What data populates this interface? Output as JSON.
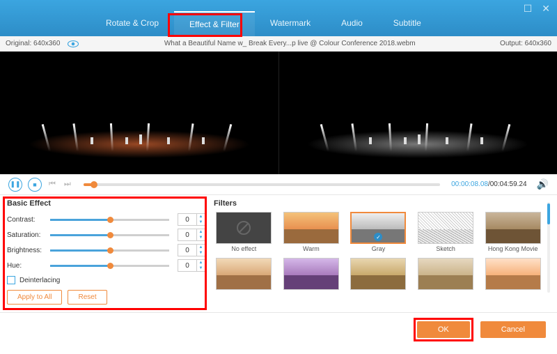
{
  "tabs": {
    "rotate": "Rotate & Crop",
    "effect": "Effect & Filter",
    "watermark": "Watermark",
    "audio": "Audio",
    "subtitle": "Subtitle"
  },
  "info": {
    "original": "Original: 640x360",
    "filename": "What a Beautiful Name w_ Break Every...p live @ Colour Conference 2018.webm",
    "output": "Output: 640x360"
  },
  "transport": {
    "current_time": "00:00:08.08",
    "total_time": "/00:04:59.24"
  },
  "basic": {
    "title": "Basic Effect",
    "rows": {
      "contrast": {
        "label": "Contrast:",
        "value": "0"
      },
      "saturation": {
        "label": "Saturation:",
        "value": "0"
      },
      "brightness": {
        "label": "Brightness:",
        "value": "0"
      },
      "hue": {
        "label": "Hue:",
        "value": "0"
      }
    },
    "deinterlacing": "Deinterlacing",
    "apply_all": "Apply to All",
    "reset": "Reset"
  },
  "filters": {
    "title": "Filters",
    "items": {
      "none": "No effect",
      "warm": "Warm",
      "gray": "Gray",
      "sketch": "Sketch",
      "hkmovie": "Hong Kong Movie"
    }
  },
  "footer": {
    "ok": "OK",
    "cancel": "Cancel"
  }
}
